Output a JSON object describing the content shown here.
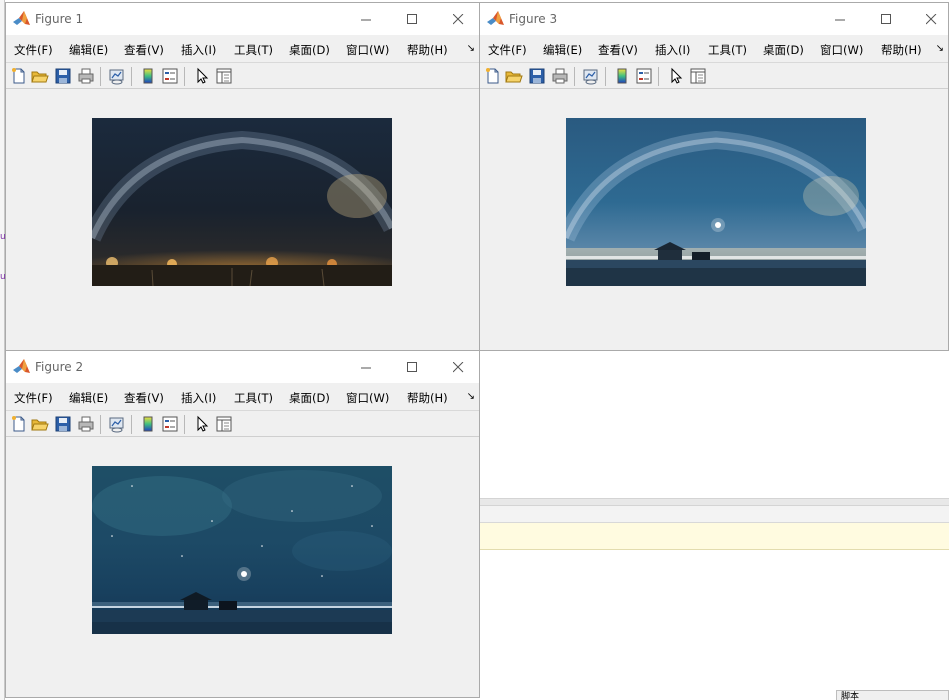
{
  "desktop": {
    "status_label": "脚本"
  },
  "menu": [
    "文件(F)",
    "编辑(E)",
    "查看(V)",
    "插入(I)",
    "工具(T)",
    "桌面(D)",
    "窗口(W)",
    "帮助(H)"
  ],
  "menu_overflow_glyph": "↘",
  "toolbar_icons": [
    "new-figure-icon",
    "open-file-icon",
    "save-icon",
    "print-icon",
    "link-plot-icon",
    "insert-colorbar-icon",
    "insert-legend-icon",
    "edit-plot-pointer-icon",
    "property-inspector-icon"
  ],
  "windows": {
    "figure1": {
      "title": "Figure 1",
      "image": "Milky way arch over dark landscape with orange city-light horizon"
    },
    "figure2": {
      "title": "Figure 2",
      "image": "Teal starry night sky over calm water with small cabin and bright star"
    },
    "figure3": {
      "title": "Figure 3",
      "image": "Blended image: milky way arch over water with cabin and bright star"
    }
  },
  "colors": {
    "window_bg": "#f0f0f0",
    "titlebar_bg": "#ffffff",
    "title_text": "#666666",
    "hint_bar": "#fffbe0"
  }
}
